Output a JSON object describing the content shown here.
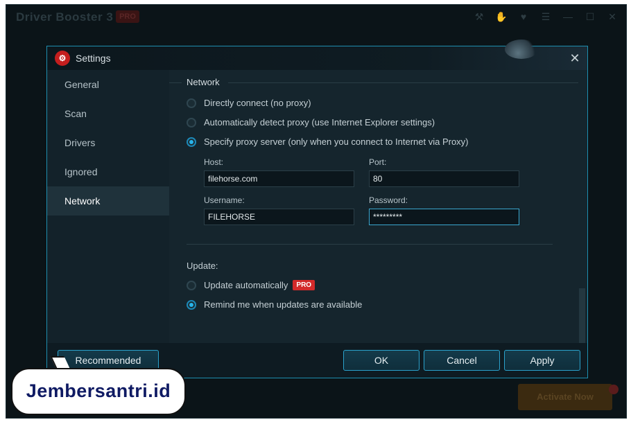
{
  "app": {
    "title": "Driver Booster 3",
    "badge": "PRO",
    "controls": [
      "⚒",
      "✋",
      "♥",
      "☰",
      "—",
      "☐",
      "✕"
    ],
    "activate_label": "Activate Now"
  },
  "dialog": {
    "title": "Settings",
    "close_glyph": "✕",
    "logo_glyph": "⚙"
  },
  "sidebar": {
    "items": [
      {
        "label": "General"
      },
      {
        "label": "Scan"
      },
      {
        "label": "Drivers"
      },
      {
        "label": "Ignored"
      },
      {
        "label": "Network",
        "active": true
      }
    ]
  },
  "network": {
    "section_title": "Network",
    "options": [
      {
        "label": "Directly connect (no proxy)",
        "checked": false
      },
      {
        "label": "Automatically detect proxy (use Internet Explorer settings)",
        "checked": false
      },
      {
        "label": "Specify proxy server (only when you connect to Internet via Proxy)",
        "checked": true
      }
    ],
    "host_label": "Host:",
    "host_value": "filehorse.com",
    "port_label": "Port:",
    "port_value": "80",
    "username_label": "Username:",
    "username_value": "FILEHORSE",
    "password_label": "Password:",
    "password_value": "*********"
  },
  "update": {
    "section_title": "Update:",
    "options": [
      {
        "label": "Update automatically",
        "checked": false,
        "badge": "PRO"
      },
      {
        "label": "Remind me when updates are available",
        "checked": true
      }
    ]
  },
  "footer": {
    "recommended_label": "Recommended",
    "ok_label": "OK",
    "cancel_label": "Cancel",
    "apply_label": "Apply"
  },
  "watermark": {
    "text": "Jembersantri.id"
  }
}
